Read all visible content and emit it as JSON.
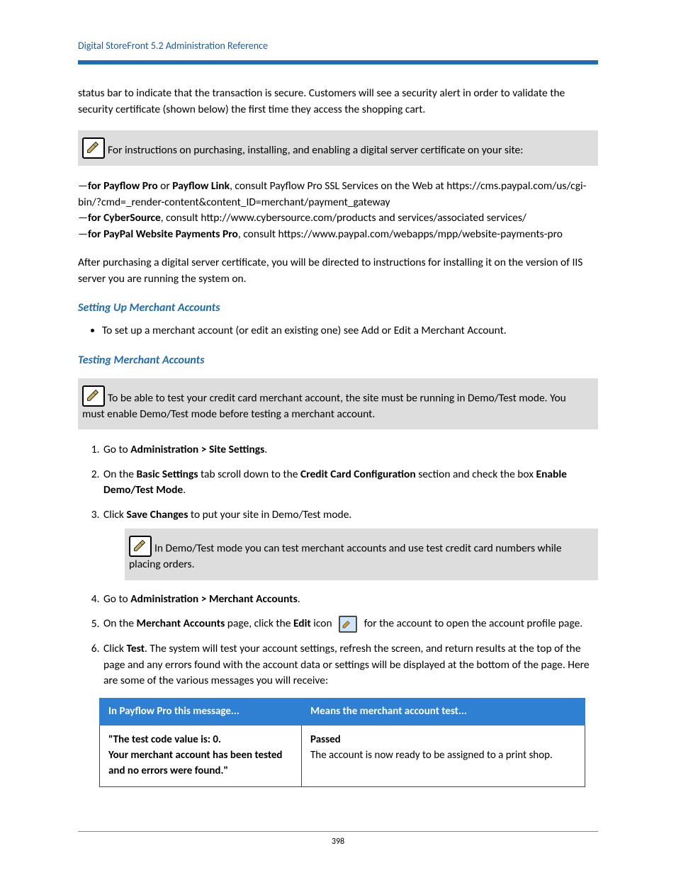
{
  "header": "Digital StoreFront 5.2 Administration Reference",
  "intro_p1": "status bar to indicate that the transaction is secure. Customers will see a security alert in order to validate the security certificate (shown below) the first time they access the shopping cart.",
  "note1": "For instructions on purchasing, installing, and enabling a digital server certificate on your site:",
  "certs": {
    "pf_bold": "for Payflow Pro",
    "pf_or": " or ",
    "pf_link_bold": "Payflow Link",
    "pf_text": ", consult Payflow Pro SSL Services on the Web at https://cms.paypal.com/us/cgi-bin/?cmd=_render-content&content_ID=merchant/payment_gateway",
    "cs_bold": "for CyberSource",
    "cs_text": ", consult http://www.cybersource.com/products and services/associated services/",
    "pp_bold": "for PayPal Website Payments Pro",
    "pp_text": ", consult https://www.paypal.com/webapps/mpp/website-payments-pro"
  },
  "after_cert": "After purchasing a digital server certificate, you will be directed to instructions for installing it on the version of IIS server you are running the system on.",
  "h_setup": "Setting Up Merchant Accounts",
  "setup_bullet": "To set up a merchant account (or edit an existing one) see Add or Edit a Merchant Account.",
  "h_testing": "Testing Merchant Accounts",
  "note2": "To be able to test your credit card merchant account, the site must be running in Demo/Test mode. You must enable Demo/Test mode before testing a merchant account.",
  "steps": {
    "s1_a": "Go to ",
    "s1_b": "Administration > Site Settings",
    "s1_c": ".",
    "s2_a": "On the ",
    "s2_b": "Basic Settings",
    "s2_c": " tab scroll down to the ",
    "s2_d": "Credit Card Configuration",
    "s2_e": " section and check the box ",
    "s2_f": "Enable Demo/Test Mode",
    "s2_g": ".",
    "s3_a": "Click ",
    "s3_b": "Save Changes",
    "s3_c": " to put your site in Demo/Test mode.",
    "note3": "In Demo/Test mode you can test merchant accounts and use test credit card numbers while placing orders.",
    "s4_a": "Go to ",
    "s4_b": "Administration > Merchant Accounts",
    "s4_c": ".",
    "s5_a": "On the ",
    "s5_b": "Merchant Accounts",
    "s5_c": " page, click the ",
    "s5_d": "Edit",
    "s5_e": " icon ",
    "s5_f": " for the account to open the account profile page.",
    "s6_a": "Click ",
    "s6_b": "Test",
    "s6_c": ". The system will test your account settings, refresh the screen, and return results at the top of the page and any errors found with the account data or settings will be displayed at the bottom of the page. Here are some of the various messages you will receive:"
  },
  "table": {
    "h1": "In Payflow Pro this message...",
    "h2": "Means the merchant account test...",
    "r1c1_a": "\"The test code value is: 0.",
    "r1c1_b": "Your merchant account has been tested and no errors were found.\"",
    "r1c2_a": "Passed",
    "r1c2_b": "The account is now ready to be assigned to a print shop."
  },
  "page_num": "398"
}
